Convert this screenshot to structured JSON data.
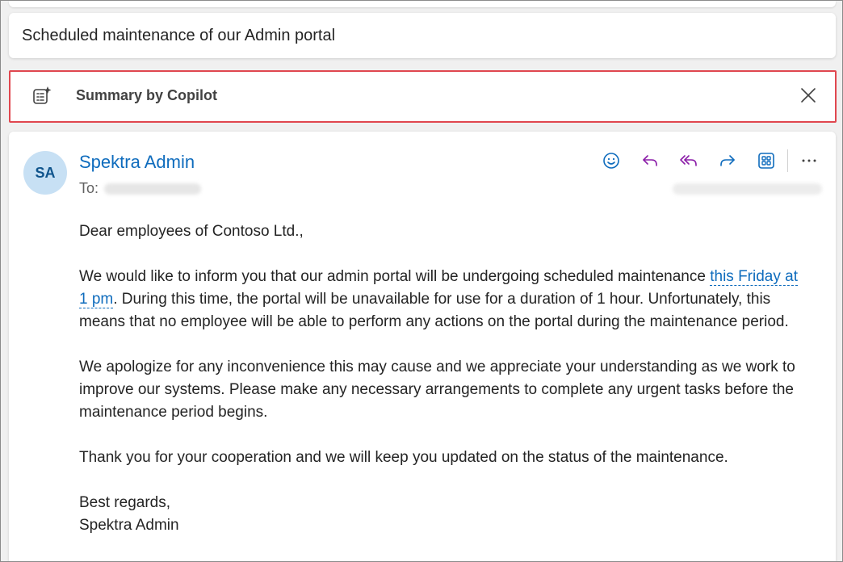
{
  "subject": "Scheduled maintenance of our Admin portal",
  "copilot": {
    "label": "Summary by Copilot",
    "icon": "copilot-summary-icon"
  },
  "message": {
    "avatar_initials": "SA",
    "sender": "Spektra Admin",
    "to_label": "To:",
    "actions": [
      "emoji-icon",
      "reply-icon",
      "reply-all-icon",
      "forward-icon",
      "apps-icon",
      "more-icon"
    ],
    "body": {
      "greeting": "Dear employees of Contoso Ltd.,",
      "p1_before": "We would like to inform you that our admin portal will be undergoing scheduled maintenance ",
      "p1_link": "this Friday at 1 pm",
      "p1_after": ". During this time, the portal will be unavailable for use for a duration of 1 hour. Unfortunately, this means that no employee will be able to perform any actions on the portal during the maintenance period.",
      "p2": "We apologize for any inconvenience this may cause and we appreciate your understanding as we work to improve our systems. Please make any necessary arrangements to complete any urgent tasks before the maintenance period begins.",
      "p3": "Thank you for your cooperation and we will keep you updated on the status of the maintenance.",
      "closing": "Best regards,",
      "signature": "Spektra Admin"
    }
  },
  "colors": {
    "accent": "#0f6cbd",
    "highlight_border": "#e0474f",
    "reply_all": "#8b1da8"
  }
}
